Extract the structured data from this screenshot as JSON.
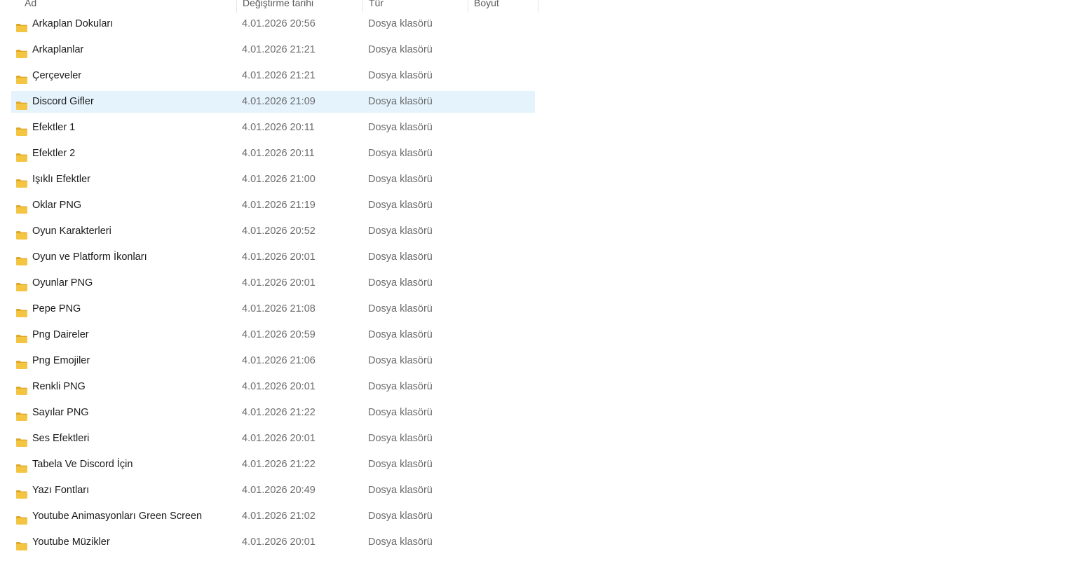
{
  "columns": {
    "name": "Ad",
    "date": "Değiştirme tarihi",
    "type": "Tür",
    "size": "Boyut"
  },
  "colors": {
    "folder": "#f4c542",
    "folder_dark": "#e0a92a",
    "selection": "#e5f3fd"
  },
  "icon": "folder-icon",
  "selected_index": 3,
  "files": [
    {
      "name": "Arkaplan Dokuları",
      "date": "4.01.2026 20:56",
      "type": "Dosya klasörü",
      "size": ""
    },
    {
      "name": "Arkaplanlar",
      "date": "4.01.2026 21:21",
      "type": "Dosya klasörü",
      "size": ""
    },
    {
      "name": "Çerçeveler",
      "date": "4.01.2026 21:21",
      "type": "Dosya klasörü",
      "size": ""
    },
    {
      "name": "Discord Gifler",
      "date": "4.01.2026 21:09",
      "type": "Dosya klasörü",
      "size": ""
    },
    {
      "name": "Efektler 1",
      "date": "4.01.2026 20:11",
      "type": "Dosya klasörü",
      "size": ""
    },
    {
      "name": "Efektler 2",
      "date": "4.01.2026 20:11",
      "type": "Dosya klasörü",
      "size": ""
    },
    {
      "name": "Işıklı Efektler",
      "date": "4.01.2026 21:00",
      "type": "Dosya klasörü",
      "size": ""
    },
    {
      "name": "Oklar PNG",
      "date": "4.01.2026 21:19",
      "type": "Dosya klasörü",
      "size": ""
    },
    {
      "name": "Oyun Karakterleri",
      "date": "4.01.2026 20:52",
      "type": "Dosya klasörü",
      "size": ""
    },
    {
      "name": "Oyun ve Platform İkonları",
      "date": "4.01.2026 20:01",
      "type": "Dosya klasörü",
      "size": ""
    },
    {
      "name": "Oyunlar PNG",
      "date": "4.01.2026 20:01",
      "type": "Dosya klasörü",
      "size": ""
    },
    {
      "name": "Pepe PNG",
      "date": "4.01.2026 21:08",
      "type": "Dosya klasörü",
      "size": ""
    },
    {
      "name": "Png Daireler",
      "date": "4.01.2026 20:59",
      "type": "Dosya klasörü",
      "size": ""
    },
    {
      "name": "Png Emojiler",
      "date": "4.01.2026 21:06",
      "type": "Dosya klasörü",
      "size": ""
    },
    {
      "name": "Renkli PNG",
      "date": "4.01.2026 20:01",
      "type": "Dosya klasörü",
      "size": ""
    },
    {
      "name": "Sayılar PNG",
      "date": "4.01.2026 21:22",
      "type": "Dosya klasörü",
      "size": ""
    },
    {
      "name": "Ses Efektleri",
      "date": "4.01.2026 20:01",
      "type": "Dosya klasörü",
      "size": ""
    },
    {
      "name": "Tabela Ve Discord İçin",
      "date": "4.01.2026 21:22",
      "type": "Dosya klasörü",
      "size": ""
    },
    {
      "name": "Yazı Fontları",
      "date": "4.01.2026 20:49",
      "type": "Dosya klasörü",
      "size": ""
    },
    {
      "name": "Youtube Animasyonları Green Screen",
      "date": "4.01.2026 21:02",
      "type": "Dosya klasörü",
      "size": ""
    },
    {
      "name": "Youtube Müzikler",
      "date": "4.01.2026 20:01",
      "type": "Dosya klasörü",
      "size": ""
    }
  ]
}
